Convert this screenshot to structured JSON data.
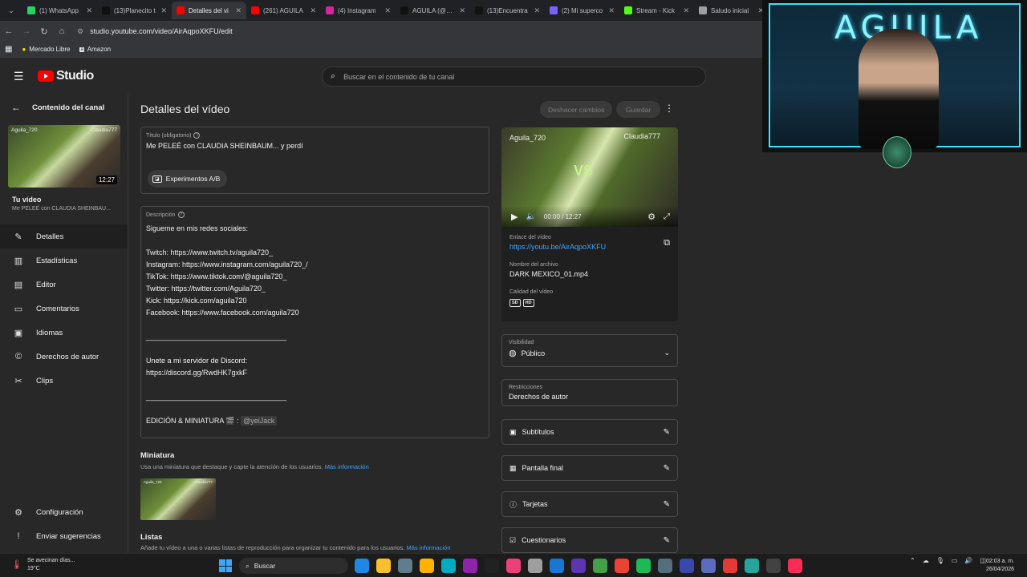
{
  "browser": {
    "tabs": [
      {
        "label": "(1) WhatsApp",
        "color": "#25d366"
      },
      {
        "label": "(13)Planecito t",
        "color": "#111111"
      },
      {
        "label": "Detalles del vi",
        "color": "#ff0000"
      },
      {
        "label": "(261) AGUILA",
        "color": "#ff0000"
      },
      {
        "label": "(4) Instagram",
        "color": "#d6249f"
      },
      {
        "label": "AGUILA (@agu",
        "color": "#111111"
      },
      {
        "label": "(13)Encuentra",
        "color": "#111111"
      },
      {
        "label": "(2) Mi superco",
        "color": "#7b61ff"
      },
      {
        "label": "Stream - Kick",
        "color": "#53fc18"
      },
      {
        "label": "Saludo inicial",
        "color": "#9aa0a6"
      }
    ],
    "url": "studio.youtube.com/video/AirAqpoXKFU/edit",
    "bookmarks": [
      "Mercado Libre",
      "Amazon"
    ]
  },
  "header": {
    "logo_text": "Studio",
    "search_placeholder": "Buscar en el contenido de tu canal"
  },
  "sidebar": {
    "back_label": "Contenido del canal",
    "thumb_duration": "12:27",
    "thumb_name_left": "Aguila_720",
    "thumb_name_right": "Claudia777",
    "your_video_label": "Tu vídeo",
    "your_video_title": "Me PELEÉ con CLAUDIA SHEINBAU...",
    "items": [
      {
        "label": "Detalles",
        "icon": "pencil-icon"
      },
      {
        "label": "Estadísticas",
        "icon": "analytics-icon"
      },
      {
        "label": "Editor",
        "icon": "film-icon"
      },
      {
        "label": "Comentarios",
        "icon": "comment-icon"
      },
      {
        "label": "Idiomas",
        "icon": "subtitles-icon"
      },
      {
        "label": "Derechos de autor",
        "icon": "copyright-icon"
      },
      {
        "label": "Clips",
        "icon": "scissors-icon"
      }
    ],
    "bottom_items": [
      {
        "label": "Configuración",
        "icon": "gear-icon"
      },
      {
        "label": "Enviar sugerencias",
        "icon": "feedback-icon"
      }
    ]
  },
  "main": {
    "page_title": "Detalles del vídeo",
    "undo_label": "Deshacer cambios",
    "save_label": "Guardar",
    "title_label": "Título (obligatorio)",
    "title_value": "Me PELEÉ con CLAUDIA SHEINBAUM... y perdí",
    "ab_label": "Experimentos A/B",
    "description_label": "Descripción",
    "description_lines": [
      "Sigueme en mis redes sociales:",
      "",
      "Twitch: https://www.twitch.tv/aguila720_",
      "Instagram: https://www.instagram.com/aguila720_/",
      "TikTok: https://www.tiktok.com/@aguila720_",
      "Twitter: https://twitter.com/Aguila720_",
      "Kick: https://kick.com/aguila720",
      "Facebook: https://www.facebook.com/aguila720",
      "",
      "___________________________________",
      "",
      "Unete a mi servidor de Discord:",
      "https://discord.gg/RwdHK7gxkF",
      "",
      "___________________________________",
      "",
      "EDICIÓN & MINIATURA 🎬 :"
    ],
    "description_mention": "@yeiJack",
    "thumbnail_title": "Miniatura",
    "thumbnail_sub": "Usa una miniatura que destaque y capte la atención de los usuarios.",
    "thumbnail_link": "Más información",
    "lists_title": "Listas",
    "lists_sub": "Añade tu vídeo a una o varias listas de reproducción para organizar tu contenido para los usuarios.",
    "lists_link": "Más información"
  },
  "player": {
    "name_left": "Aguila_720",
    "name_right": "Claudia777",
    "vs_text": "VS",
    "time": "00:00 / 12:27",
    "link_label": "Enlace del vídeo",
    "link_value": "https://youtu.be/AirAqpoXKFU",
    "filename_label": "Nombre del archivo",
    "filename_value": "DARK MEXICO_01.mp4",
    "quality_label": "Calidad del vídeo",
    "quality_badges": [
      "SD",
      "HD"
    ]
  },
  "right": {
    "visibility_label": "Visibilidad",
    "visibility_value": "Público",
    "restrictions_label": "Restricciones",
    "restrictions_value": "Derechos de autor",
    "rows": [
      {
        "label": "Subtítulos",
        "icon": "subtitles-icon"
      },
      {
        "label": "Pantalla final",
        "icon": "end-screen-icon"
      },
      {
        "label": "Tarjetas",
        "icon": "info-icon"
      },
      {
        "label": "Cuestionarios",
        "icon": "checkbox-icon"
      }
    ]
  },
  "webcam": {
    "neon_text": "AGUILA"
  },
  "taskbar": {
    "weather_text": "Se avecinan días...",
    "weather_temp": "19°C",
    "search_label": "Buscar",
    "time": "02:03 a. m.",
    "date": "26/04/2026"
  }
}
